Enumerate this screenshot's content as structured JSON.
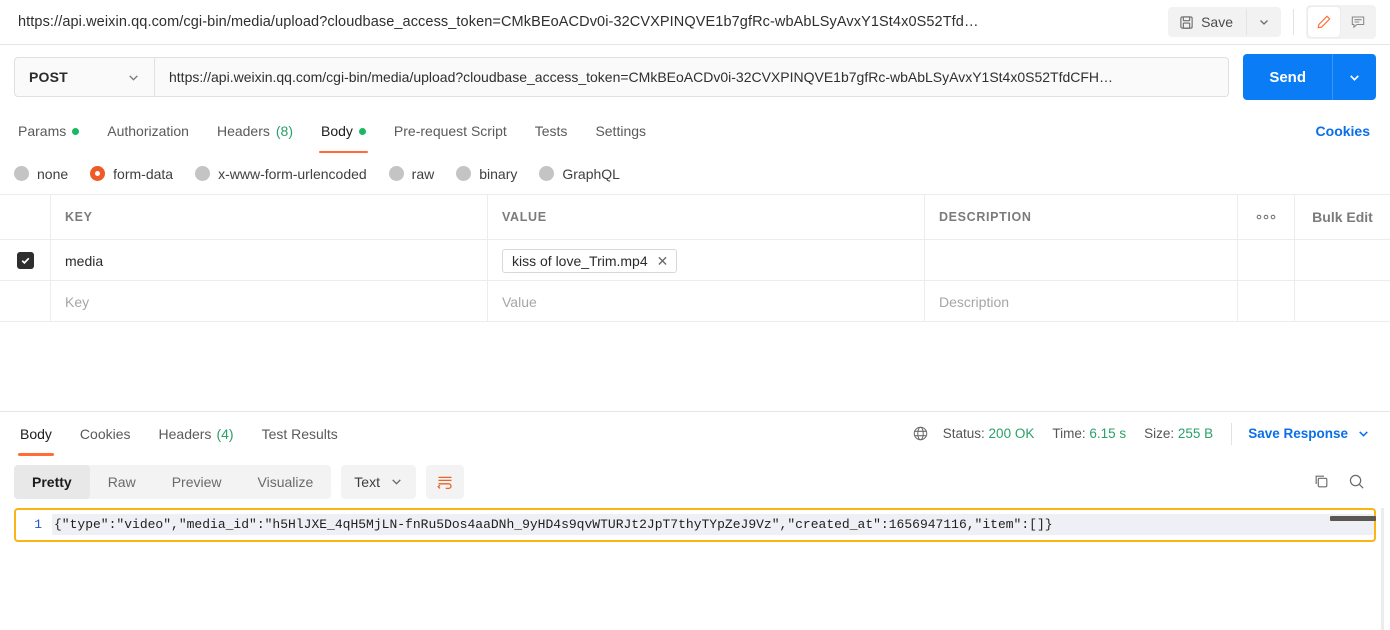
{
  "topbar": {
    "request_title": "https://api.weixin.qq.com/cgi-bin/media/upload?cloudbase_access_token=CMkBEoACDv0i-32CVXPINQVE1b7gfRc-wbAbLSyAvxY1St4x0S52Tfd…",
    "save_label": "Save",
    "save_icon": "floppy-disk-icon",
    "save_caret_icon": "chevron-down-icon",
    "edit_icon": "pencil-icon",
    "comment_icon": "comment-icon"
  },
  "urlrow": {
    "method": "POST",
    "method_caret_icon": "chevron-down-icon",
    "url": "https://api.weixin.qq.com/cgi-bin/media/upload?cloudbase_access_token=CMkBEoACDv0i-32CVXPINQVE1b7gfRc-wbAbLSyAvxY1St4x0S52TfdCFH…",
    "send_label": "Send",
    "send_caret_icon": "chevron-down-icon"
  },
  "request_tabs": {
    "items": [
      {
        "label": "Params",
        "dot": true,
        "count": "",
        "active": false
      },
      {
        "label": "Authorization",
        "dot": false,
        "count": "",
        "active": false
      },
      {
        "label": "Headers",
        "dot": false,
        "count": "(8)",
        "active": false
      },
      {
        "label": "Body",
        "dot": true,
        "count": "",
        "active": true
      },
      {
        "label": "Pre-request Script",
        "dot": false,
        "count": "",
        "active": false
      },
      {
        "label": "Tests",
        "dot": false,
        "count": "",
        "active": false
      },
      {
        "label": "Settings",
        "dot": false,
        "count": "",
        "active": false
      }
    ],
    "cookies_label": "Cookies"
  },
  "body_types": [
    {
      "label": "none",
      "selected": false
    },
    {
      "label": "form-data",
      "selected": true
    },
    {
      "label": "x-www-form-urlencoded",
      "selected": false
    },
    {
      "label": "raw",
      "selected": false
    },
    {
      "label": "binary",
      "selected": false
    },
    {
      "label": "GraphQL",
      "selected": false
    }
  ],
  "params_table": {
    "headers": {
      "key": "KEY",
      "value": "VALUE",
      "description": "DESCRIPTION",
      "more_icon": "ellipsis-icon",
      "bulk_edit": "Bulk Edit"
    },
    "rows": [
      {
        "checked": true,
        "key": "media",
        "value_chip": "kiss of love_Trim.mp4",
        "chip_remove_icon": "close-icon",
        "description": ""
      }
    ],
    "empty_row": {
      "key_placeholder": "Key",
      "value_placeholder": "Value",
      "description_placeholder": "Description"
    }
  },
  "response_tabs": {
    "items": [
      {
        "label": "Body",
        "count": "",
        "active": true
      },
      {
        "label": "Cookies",
        "count": "",
        "active": false
      },
      {
        "label": "Headers",
        "count": "(4)",
        "active": false
      },
      {
        "label": "Test Results",
        "count": "",
        "active": false
      }
    ],
    "globe_icon": "globe-icon",
    "status_label": "Status:",
    "status_value": "200 OK",
    "time_label": "Time:",
    "time_value": "6.15 s",
    "size_label": "Size:",
    "size_value": "255 B",
    "save_response_label": "Save Response",
    "save_response_caret_icon": "chevron-down-icon"
  },
  "format_bar": {
    "views": [
      {
        "label": "Pretty",
        "active": true
      },
      {
        "label": "Raw",
        "active": false
      },
      {
        "label": "Preview",
        "active": false
      },
      {
        "label": "Visualize",
        "active": false
      }
    ],
    "language": "Text",
    "language_caret_icon": "chevron-down-icon",
    "wrap_icon": "word-wrap-icon",
    "copy_icon": "copy-icon",
    "search_icon": "search-icon"
  },
  "response_body": {
    "line_number": "1",
    "content": "{\"type\":\"video\",\"media_id\":\"h5HlJXE_4qH5MjLN-fnRu5Dos4aaDNh_9yHD4s9qvWTURJt2JpT7thyTYpZeJ9Vz\",\"created_at\":1656947116,\"item\":[]}"
  },
  "colors": {
    "accent_orange": "#ff6c37",
    "send_blue": "#0a7cf5",
    "link_blue": "#0a6fe8",
    "status_green": "#2aa06a",
    "highlight_yellow": "#fbb316"
  }
}
